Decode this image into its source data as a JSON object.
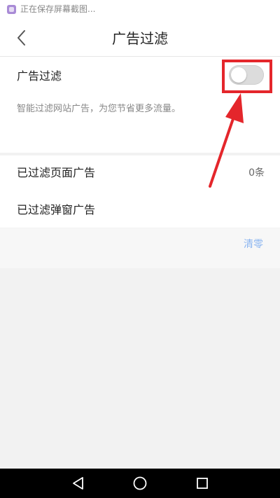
{
  "status_bar": {
    "text": "正在保存屏幕截图...",
    "icon": "screenshot-icon"
  },
  "header": {
    "title": "广告过滤",
    "back_icon": "chevron-left-icon"
  },
  "ad_filter": {
    "label": "广告过滤",
    "description": "智能过滤网站广告，为您节省更多流量。",
    "toggle_state": "off"
  },
  "stats": {
    "page_ads_label": "已过滤页面广告",
    "page_ads_value": "0条",
    "popup_ads_label": "已过滤弹窗广告",
    "clear_label": "清零"
  },
  "annotation": {
    "color": "#e4262b"
  },
  "system_nav": {
    "back_icon": "triangle-back-icon",
    "home_icon": "circle-home-icon",
    "recents_icon": "square-recents-icon"
  }
}
